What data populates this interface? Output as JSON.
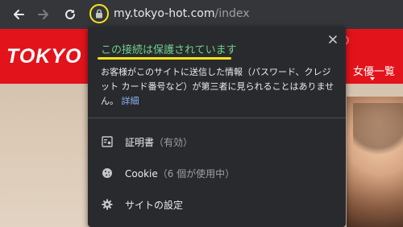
{
  "browser": {
    "url_host": "my.tokyo-hot.com",
    "url_path": "/index",
    "icons": [
      "back-arrow-icon",
      "forward-arrow-icon",
      "reload-icon",
      "lock-icon"
    ]
  },
  "page": {
    "logo_text": "TOKYO",
    "nav_item": "女優一覧"
  },
  "popup": {
    "title": "この接続は保護されています",
    "description": "お客様がこのサイトに送信した情報（パスワード、クレジット カード番号など）が第三者に見られることはありません。",
    "details_link": "詳細",
    "menu": [
      {
        "label": "証明書",
        "sub": "（有効）",
        "icon": "certificate-icon"
      },
      {
        "label": "Cookie",
        "sub": "（6 個が使用中）",
        "icon": "cookie-icon"
      },
      {
        "label": "サイトの設定",
        "sub": "",
        "icon": "gear-icon"
      }
    ]
  },
  "colors": {
    "toolbar": "#35363a",
    "popup_bg": "#292a2d",
    "secure_green": "#6fd18b",
    "highlight_yellow": "#f5e51c",
    "link_blue": "#8ab4f8",
    "brand_red": "#e3131b"
  }
}
